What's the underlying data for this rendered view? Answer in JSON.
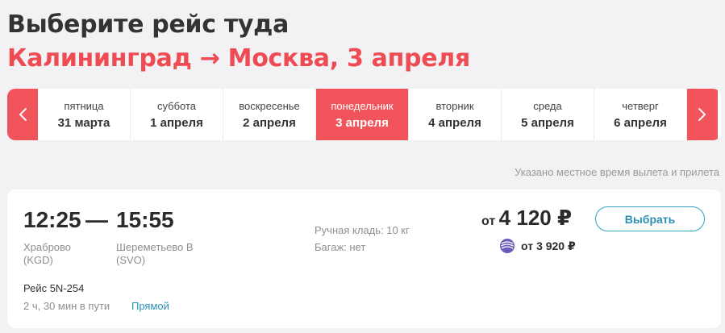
{
  "header": {
    "title": "Выберите рейс туда",
    "route": "Калининград → Москва, 3 апреля"
  },
  "datebar": {
    "prev_icon": "chevron-left-icon",
    "next_icon": "chevron-right-icon",
    "days": [
      {
        "dow": "пятница",
        "date": "31 марта",
        "active": false
      },
      {
        "dow": "суббота",
        "date": "1 апреля",
        "active": false
      },
      {
        "dow": "воскресенье",
        "date": "2 апреля",
        "active": false
      },
      {
        "dow": "понедельник",
        "date": "3 апреля",
        "active": true
      },
      {
        "dow": "вторник",
        "date": "4 апреля",
        "active": false
      },
      {
        "dow": "среда",
        "date": "5 апреля",
        "active": false
      },
      {
        "dow": "четверг",
        "date": "6 апреля",
        "active": false
      }
    ]
  },
  "note": "Указано местное время вылета и прилета",
  "flight": {
    "departure_time": "12:25",
    "separator": "—",
    "arrival_time": "15:55",
    "departure_airport": "Храброво",
    "departure_code": "(KGD)",
    "arrival_airport": "Шереметьево B",
    "arrival_code": "(SVO)",
    "hand_luggage": "Ручная кладь: 10 кг",
    "baggage": "Багаж: нет",
    "price_prefix": "от",
    "price": "4 120 ₽",
    "alt_price_prefix": "от",
    "alt_price": "3 920 ₽",
    "loyalty_icon": "loyalty-program-icon",
    "select_label": "Выбрать",
    "flight_number": "Рейс 5N-254",
    "duration": "2 ч, 30 мин в пути",
    "direct_label": "Прямой"
  },
  "colors": {
    "accent": "#f2545b",
    "route_text": "#ee4b52",
    "link": "#2a8fb3",
    "background": "#f2f2f4"
  }
}
